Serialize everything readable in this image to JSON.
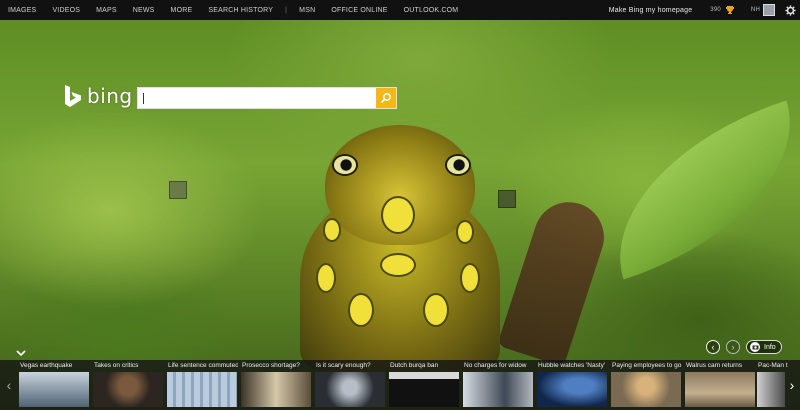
{
  "topnav": {
    "items": [
      "IMAGES",
      "VIDEOS",
      "MAPS",
      "NEWS",
      "MORE",
      "SEARCH HISTORY"
    ],
    "separator": "|",
    "secondary": [
      "MSN",
      "OFFICE ONLINE",
      "OUTLOOK.COM"
    ],
    "homepage_link": "Make Bing my homepage",
    "rewards_count": "390",
    "signin_text": "NH"
  },
  "logo": {
    "text": "bing",
    "color": "#ffffff"
  },
  "search": {
    "value": "",
    "placeholder": "",
    "button_color": "#f3b71a"
  },
  "image_controls": {
    "prev": "‹",
    "next": "›",
    "info_label": "Info"
  },
  "news": {
    "prev": "‹",
    "next": "›",
    "items": [
      {
        "caption": "Vegas earthquake",
        "thumb": "#6b7d8f"
      },
      {
        "caption": "Takes on critics",
        "thumb": "#3b3024"
      },
      {
        "caption": "Life sentence commuted",
        "thumb": "#9fb4c8"
      },
      {
        "caption": "Prosecco shortage?",
        "thumb": "#8a7a5a"
      },
      {
        "caption": "Is it scary enough?",
        "thumb": "#4a4f55"
      },
      {
        "caption": "Dutch burqa ban",
        "thumb": "#2b2b2b"
      },
      {
        "caption": "No charges for widow",
        "thumb": "#7f8a99"
      },
      {
        "caption": "Hubble watches 'Nasty'",
        "thumb": "#1a3d70"
      },
      {
        "caption": "Paying employees to go",
        "thumb": "#caa15a"
      },
      {
        "caption": "Walrus cam returns",
        "thumb": "#9b8a6e"
      },
      {
        "caption": "Pac-Man t",
        "thumb": "#5a5a5a"
      }
    ]
  },
  "colors": {
    "topbar_bg": "#111111",
    "accent": "#f3b71a"
  }
}
